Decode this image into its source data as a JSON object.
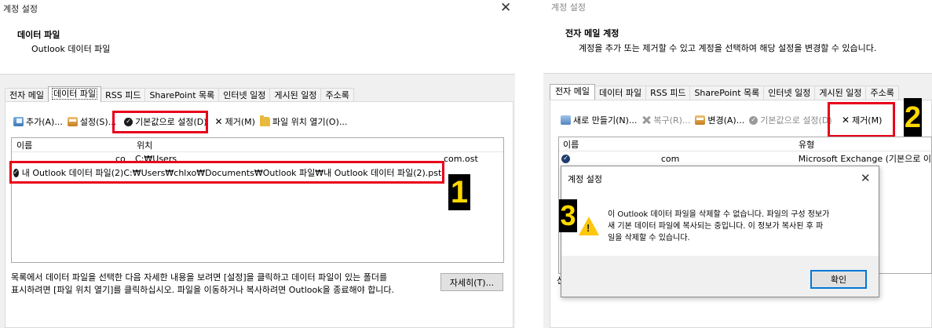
{
  "left": {
    "window_title": "계정 설정",
    "header_title": "데이터 파일",
    "header_subtitle": "Outlook 데이터 파일",
    "tabs": [
      "전자 메일",
      "데이터 파일",
      "RSS 피드",
      "SharePoint 목록",
      "인터넷 일정",
      "게시된 일정",
      "주소록"
    ],
    "toolbar": {
      "add": "추가(A)...",
      "settings": "설정(S)...",
      "set_default": "기본값으로 설정(D)",
      "remove": "제거(M)",
      "open_location": "파일 위치 열기(O)..."
    },
    "columns": [
      "이름",
      "위치"
    ],
    "rows": [
      {
        "name": "",
        "location_prefix": "C:₩Users",
        "location_suffix": "com.ost"
      },
      {
        "name": "내 Outlook 데이터 파일(2)",
        "location": "C:₩Users₩chlxo₩Documents₩Outlook 파일₩내 Outlook 데이터 파일(2).pst"
      }
    ],
    "footer_text_1": "목록에서 데이터 파일을 선택한 다음 자세한 내용을 보려면 [설정]을 클릭하고 데이터 파일이 있는 폴더를",
    "footer_text_2": "표시하려면 [파일 위치 열기]를 클릭하십시오. 파일을 이동하거나 복사하려면 Outlook을 종료해야 합니다.",
    "details_button": "자세히(T)...",
    "step_badge": "1"
  },
  "right": {
    "window_title": "계정 설정",
    "header_title": "전자 메일 계정",
    "header_subtitle": "계정을 추가 또는 제거할 수 있고 계정을 선택하여 해당 설정을 변경할 수 있습니다.",
    "tabs": [
      "전자 메일",
      "데이터 파일",
      "RSS 피드",
      "SharePoint 목록",
      "인터넷 일정",
      "게시된 일정",
      "주소록"
    ],
    "toolbar": {
      "new": "새로 만들기(N)...",
      "repair": "복구(R)...",
      "change": "변경(A)...",
      "set_default": "기본값으로 설정(D)",
      "remove": "제거(M)"
    },
    "columns": [
      "이름",
      "유형"
    ],
    "row": {
      "name_suffix": "com",
      "type": "Microsoft Exchange (기본으로 이"
    },
    "step_badge_remove": "2",
    "step_badge_dialog": "3",
    "dialog": {
      "title": "계정 설정",
      "message_1": "이 Outlook 데이터 파일을 삭제할 수 없습니다. 파일의 구성 정보가",
      "message_2": "새 기본 데이터 파일에 복사되는 중입니다. 이 정보가 복사된 후 파",
      "message_3": "일을 삭제할 수 있습니다.",
      "ok_button": "확인"
    },
    "stray_char": "선"
  },
  "colors": {
    "highlight_red": "#e8001b",
    "badge_bg": "#000000",
    "badge_fg": "#ffd800",
    "warning": "#ffc60b"
  }
}
